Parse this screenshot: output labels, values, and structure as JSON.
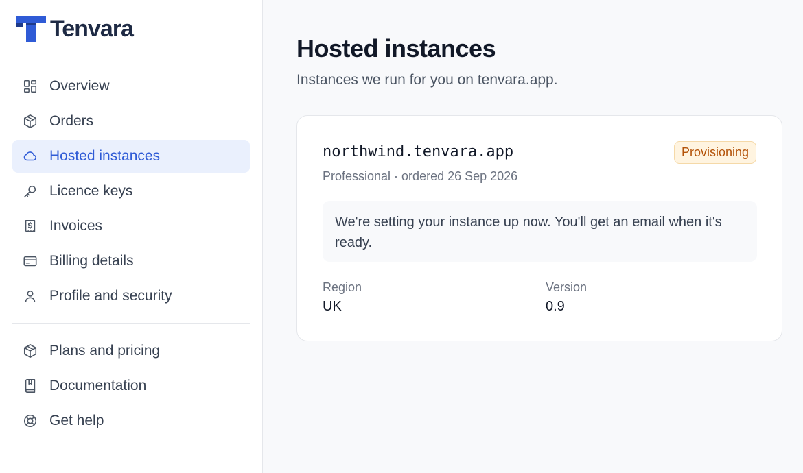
{
  "brand": {
    "name": "Tenvara",
    "accent": "#2f5bd6"
  },
  "nav": {
    "primary": [
      {
        "label": "Overview",
        "icon": "dashboard-icon"
      },
      {
        "label": "Orders",
        "icon": "box-icon"
      },
      {
        "label": "Hosted instances",
        "icon": "cloud-icon",
        "active": true
      },
      {
        "label": "Licence keys",
        "icon": "key-icon"
      },
      {
        "label": "Invoices",
        "icon": "receipt-icon"
      },
      {
        "label": "Billing details",
        "icon": "credit-card-icon"
      },
      {
        "label": "Profile and security",
        "icon": "user-icon"
      }
    ],
    "secondary": [
      {
        "label": "Plans and pricing",
        "icon": "box-icon"
      },
      {
        "label": "Documentation",
        "icon": "book-icon"
      },
      {
        "label": "Get help",
        "icon": "lifebuoy-icon"
      }
    ]
  },
  "page": {
    "title": "Hosted instances",
    "subtitle": "Instances we run for you on tenvara.app."
  },
  "instance": {
    "host": "northwind.tenvara.app",
    "status": "Provisioning",
    "status_color": "#b45309",
    "meta": "Professional · ordered 26 Sep 2026",
    "notice": "We're setting your instance up now. You'll get an email when it's ready.",
    "region_label": "Region",
    "region_value": "UK",
    "version_label": "Version",
    "version_value": "0.9"
  }
}
